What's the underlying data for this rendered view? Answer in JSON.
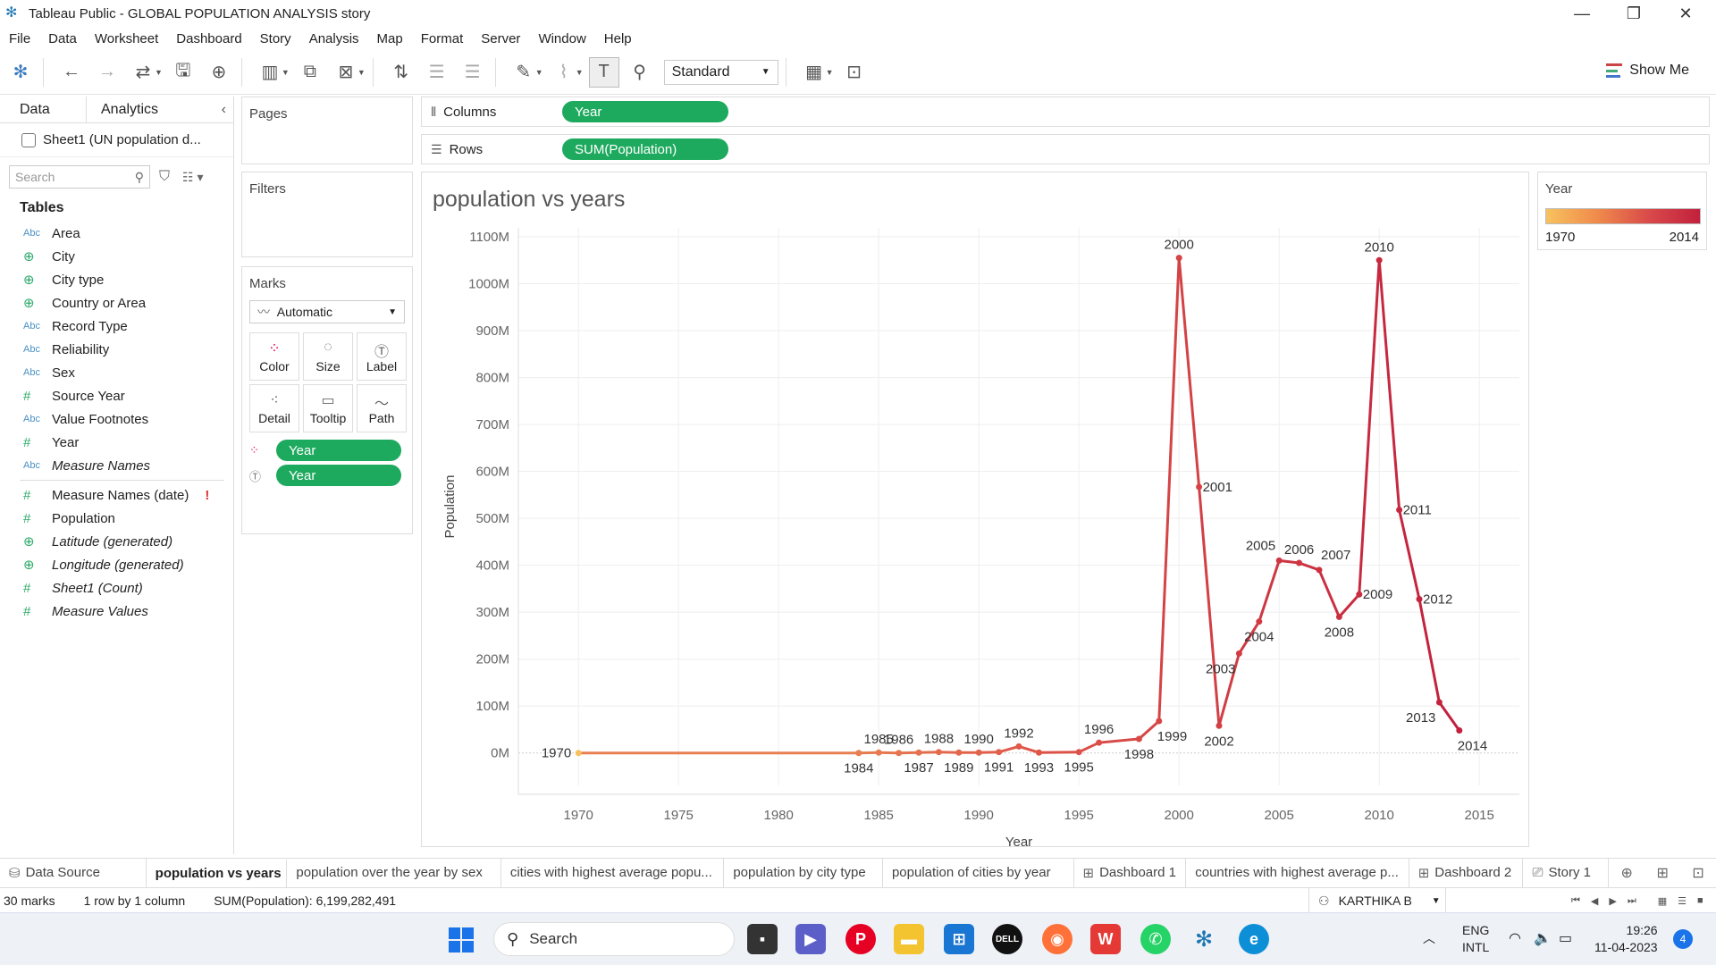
{
  "window": {
    "title": "Tableau Public - GLOBAL POPULATION ANALYSIS story"
  },
  "menu": [
    "File",
    "Data",
    "Worksheet",
    "Dashboard",
    "Story",
    "Analysis",
    "Map",
    "Format",
    "Server",
    "Window",
    "Help"
  ],
  "toolbar": {
    "fit_value": "Standard",
    "show_me": "Show Me"
  },
  "datapane": {
    "tab_data": "Data",
    "tab_analytics": "Analytics",
    "source": "Sheet1 (UN population d...",
    "search_placeholder": "Search",
    "tables_header": "Tables",
    "fields": [
      {
        "type": "Abc",
        "name": "Area"
      },
      {
        "type": "globe",
        "name": "City"
      },
      {
        "type": "globe",
        "name": "City type"
      },
      {
        "type": "globe",
        "name": "Country or Area"
      },
      {
        "type": "Abc",
        "name": "Record Type"
      },
      {
        "type": "Abc",
        "name": "Reliability"
      },
      {
        "type": "Abc",
        "name": "Sex"
      },
      {
        "type": "#",
        "name": "Source Year"
      },
      {
        "type": "Abc",
        "name": "Value Footnotes"
      },
      {
        "type": "#",
        "name": "Year"
      },
      {
        "type": "Abc",
        "name": "Measure Names"
      }
    ],
    "measures": [
      {
        "type": "#",
        "name": "Measure Names (date)"
      },
      {
        "type": "#",
        "name": "Population"
      },
      {
        "type": "globe",
        "name": "Latitude (generated)"
      },
      {
        "type": "globe",
        "name": "Longitude (generated)"
      },
      {
        "type": "#",
        "name": "Sheet1 (Count)"
      },
      {
        "type": "#",
        "name": "Measure Values"
      }
    ]
  },
  "shelves": {
    "pages": "Pages",
    "filters": "Filters",
    "marks": "Marks",
    "mark_type": "Automatic",
    "mark_cards": [
      "Color",
      "Size",
      "Label",
      "Detail",
      "Tooltip",
      "Path"
    ],
    "mark_pills": [
      "Year",
      "Year"
    ],
    "columns_label": "Columns",
    "columns_pill": "Year",
    "rows_label": "Rows",
    "rows_pill": "SUM(Population)"
  },
  "legend": {
    "title": "Year",
    "min": "1970",
    "max": "2014"
  },
  "chart_data": {
    "type": "line",
    "title": "population vs years",
    "xlabel": "Year",
    "ylabel": "Population",
    "xlim": [
      1967,
      2017
    ],
    "ylim": [
      -50,
      1100
    ],
    "x_ticks": [
      1970,
      1975,
      1980,
      1985,
      1990,
      1995,
      2000,
      2005,
      2010,
      2015
    ],
    "y_ticks": [
      0,
      100,
      200,
      300,
      400,
      500,
      600,
      700,
      800,
      900,
      1000,
      1100
    ],
    "y_tick_labels": [
      "0M",
      "100M",
      "200M",
      "300M",
      "400M",
      "500M",
      "600M",
      "700M",
      "800M",
      "900M",
      "1000M",
      "1100M"
    ],
    "y_unit": "millions",
    "color_encoding": {
      "field": "Year",
      "low": "#f7c25e",
      "mid": "#e0594a",
      "high": "#c2203d"
    },
    "grid": true,
    "points": [
      {
        "x": 1970,
        "y": 0,
        "label": "1970",
        "label_pos": "left"
      },
      {
        "x": 1984,
        "y": 0,
        "label": "1984",
        "label_pos": "below"
      },
      {
        "x": 1985,
        "y": 1,
        "label": "1985",
        "label_pos": "above"
      },
      {
        "x": 1986,
        "y": 0,
        "label": "1986",
        "label_pos": "above"
      },
      {
        "x": 1987,
        "y": 1,
        "label": "1987",
        "label_pos": "below"
      },
      {
        "x": 1988,
        "y": 2,
        "label": "1988",
        "label_pos": "above"
      },
      {
        "x": 1989,
        "y": 1,
        "label": "1989",
        "label_pos": "below"
      },
      {
        "x": 1990,
        "y": 1,
        "label": "1990",
        "label_pos": "above"
      },
      {
        "x": 1991,
        "y": 2,
        "label": "1991",
        "label_pos": "below"
      },
      {
        "x": 1992,
        "y": 14,
        "label": "1992",
        "label_pos": "above"
      },
      {
        "x": 1993,
        "y": 1,
        "label": "1993",
        "label_pos": "below"
      },
      {
        "x": 1995,
        "y": 2,
        "label": "1995",
        "label_pos": "below"
      },
      {
        "x": 1996,
        "y": 22,
        "label": "1996",
        "label_pos": "above"
      },
      {
        "x": 1998,
        "y": 30,
        "label": "1998",
        "label_pos": "below"
      },
      {
        "x": 1999,
        "y": 68,
        "label": "1999",
        "label_pos": "belowright"
      },
      {
        "x": 2000,
        "y": 1055,
        "label": "2000",
        "label_pos": "above"
      },
      {
        "x": 2001,
        "y": 567,
        "label": "2001",
        "label_pos": "right"
      },
      {
        "x": 2002,
        "y": 58,
        "label": "2002",
        "label_pos": "below"
      },
      {
        "x": 2003,
        "y": 212,
        "label": "2003",
        "label_pos": "belowleft"
      },
      {
        "x": 2004,
        "y": 280,
        "label": "2004",
        "label_pos": "below"
      },
      {
        "x": 2005,
        "y": 410,
        "label": "2005",
        "label_pos": "aboveleft"
      },
      {
        "x": 2006,
        "y": 405,
        "label": "2006",
        "label_pos": "above"
      },
      {
        "x": 2007,
        "y": 390,
        "label": "2007",
        "label_pos": "aboveright"
      },
      {
        "x": 2008,
        "y": 290,
        "label": "2008",
        "label_pos": "below"
      },
      {
        "x": 2009,
        "y": 338,
        "label": "2009",
        "label_pos": "right"
      },
      {
        "x": 2010,
        "y": 1050,
        "label": "2010",
        "label_pos": "above"
      },
      {
        "x": 2011,
        "y": 518,
        "label": "2011",
        "label_pos": "right"
      },
      {
        "x": 2012,
        "y": 328,
        "label": "2012",
        "label_pos": "right"
      },
      {
        "x": 2013,
        "y": 108,
        "label": "2013",
        "label_pos": "belowleft"
      },
      {
        "x": 2014,
        "y": 48,
        "label": "2014",
        "label_pos": "belowright"
      }
    ]
  },
  "sheet_tabs": [
    {
      "label": "Data Source",
      "icon": "data-source-icon",
      "active": false
    },
    {
      "label": "population vs years",
      "active": true
    },
    {
      "label": "population over the year by sex",
      "active": false
    },
    {
      "label": "cities with highest average popu...",
      "active": false
    },
    {
      "label": "population by city type",
      "active": false
    },
    {
      "label": "population of cities by year",
      "active": false
    },
    {
      "label": "Dashboard 1",
      "icon": "dashboard-icon",
      "active": false
    },
    {
      "label": "countries with highest average p...",
      "active": false
    },
    {
      "label": "Dashboard 2",
      "icon": "dashboard-icon",
      "active": false
    },
    {
      "label": "Story 1",
      "icon": "story-icon",
      "active": false
    }
  ],
  "status": {
    "marks": "30 marks",
    "rows_cols": "1 row by 1 column",
    "sum": "SUM(Population): 6,199,282,491",
    "user": "KARTHIKA B"
  },
  "taskbar": {
    "search": "Search",
    "lang1": "ENG",
    "lang2": "INTL",
    "time": "19:26",
    "date": "11-04-2023",
    "badge": "4"
  }
}
